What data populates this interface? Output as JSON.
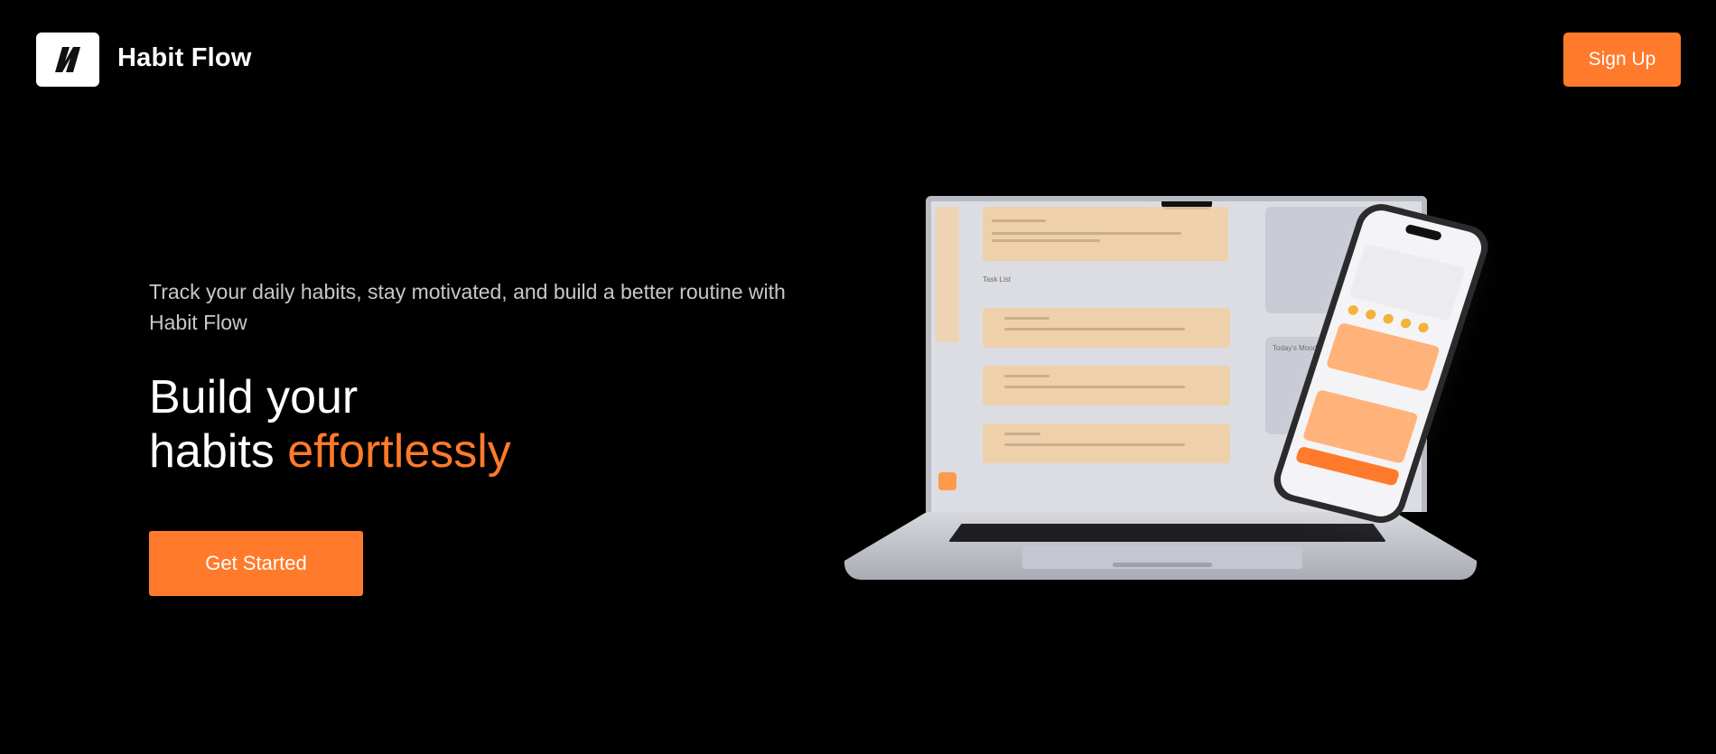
{
  "header": {
    "brand_name": "Habit Flow",
    "logo_icon": "habit-flow-logo-icon",
    "signup_label": "Sign Up"
  },
  "hero": {
    "tagline": "Track your daily habits, stay motivated, and build a better routine with Habit Flow",
    "headline_line1": "Build your",
    "headline_line2_prefix": "habits ",
    "headline_accent": "effortlessly",
    "cta_label": "Get Started"
  },
  "illustration": {
    "laptop_task_list_title": "Task List",
    "laptop_mood_title": "Today's Mood"
  },
  "colors": {
    "background": "#000000",
    "accent": "#ff7a2a",
    "text_primary": "#ffffff",
    "text_secondary": "#c8c8c8"
  }
}
